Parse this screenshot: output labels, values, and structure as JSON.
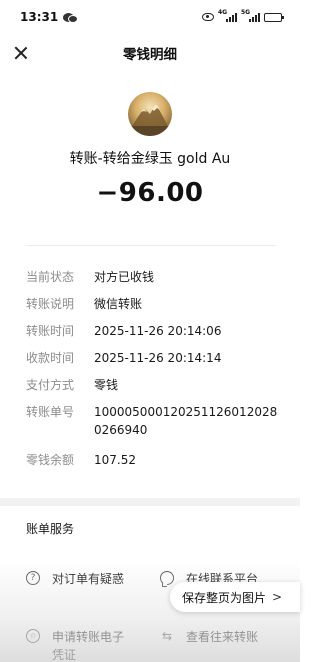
{
  "status_bar": {
    "time": "13:31",
    "network_tags": [
      "4G",
      "5G"
    ]
  },
  "nav": {
    "title": "零钱明细",
    "close_icon": "close-icon"
  },
  "transfer": {
    "payee": "转账-转给金绿玉 gold Au",
    "amount": "−96.00"
  },
  "details": [
    {
      "key": "当前状态",
      "value": "对方已收钱"
    },
    {
      "key": "转账说明",
      "value": "微信转账"
    },
    {
      "key": "转账时间",
      "value": "2025-11-26 20:14:06"
    },
    {
      "key": "收款时间",
      "value": "2025-11-26 20:14:14"
    },
    {
      "key": "支付方式",
      "value": "零钱"
    },
    {
      "key": "转账单号",
      "value": "1000050001202511260120280266940"
    },
    {
      "key": "零钱余额",
      "value": "107.52"
    }
  ],
  "services": {
    "title": "账单服务",
    "items": [
      {
        "label": "对订单有疑惑",
        "icon": "question-icon"
      },
      {
        "label": "在线联系平台",
        "icon": "chat-icon"
      },
      {
        "label": "申请转账电子凭证",
        "icon": "certificate-icon"
      },
      {
        "label": "查看往来转账",
        "icon": "swap-icon"
      }
    ]
  },
  "save_button": {
    "label": "保存整页为图片",
    "arrow": ">"
  }
}
